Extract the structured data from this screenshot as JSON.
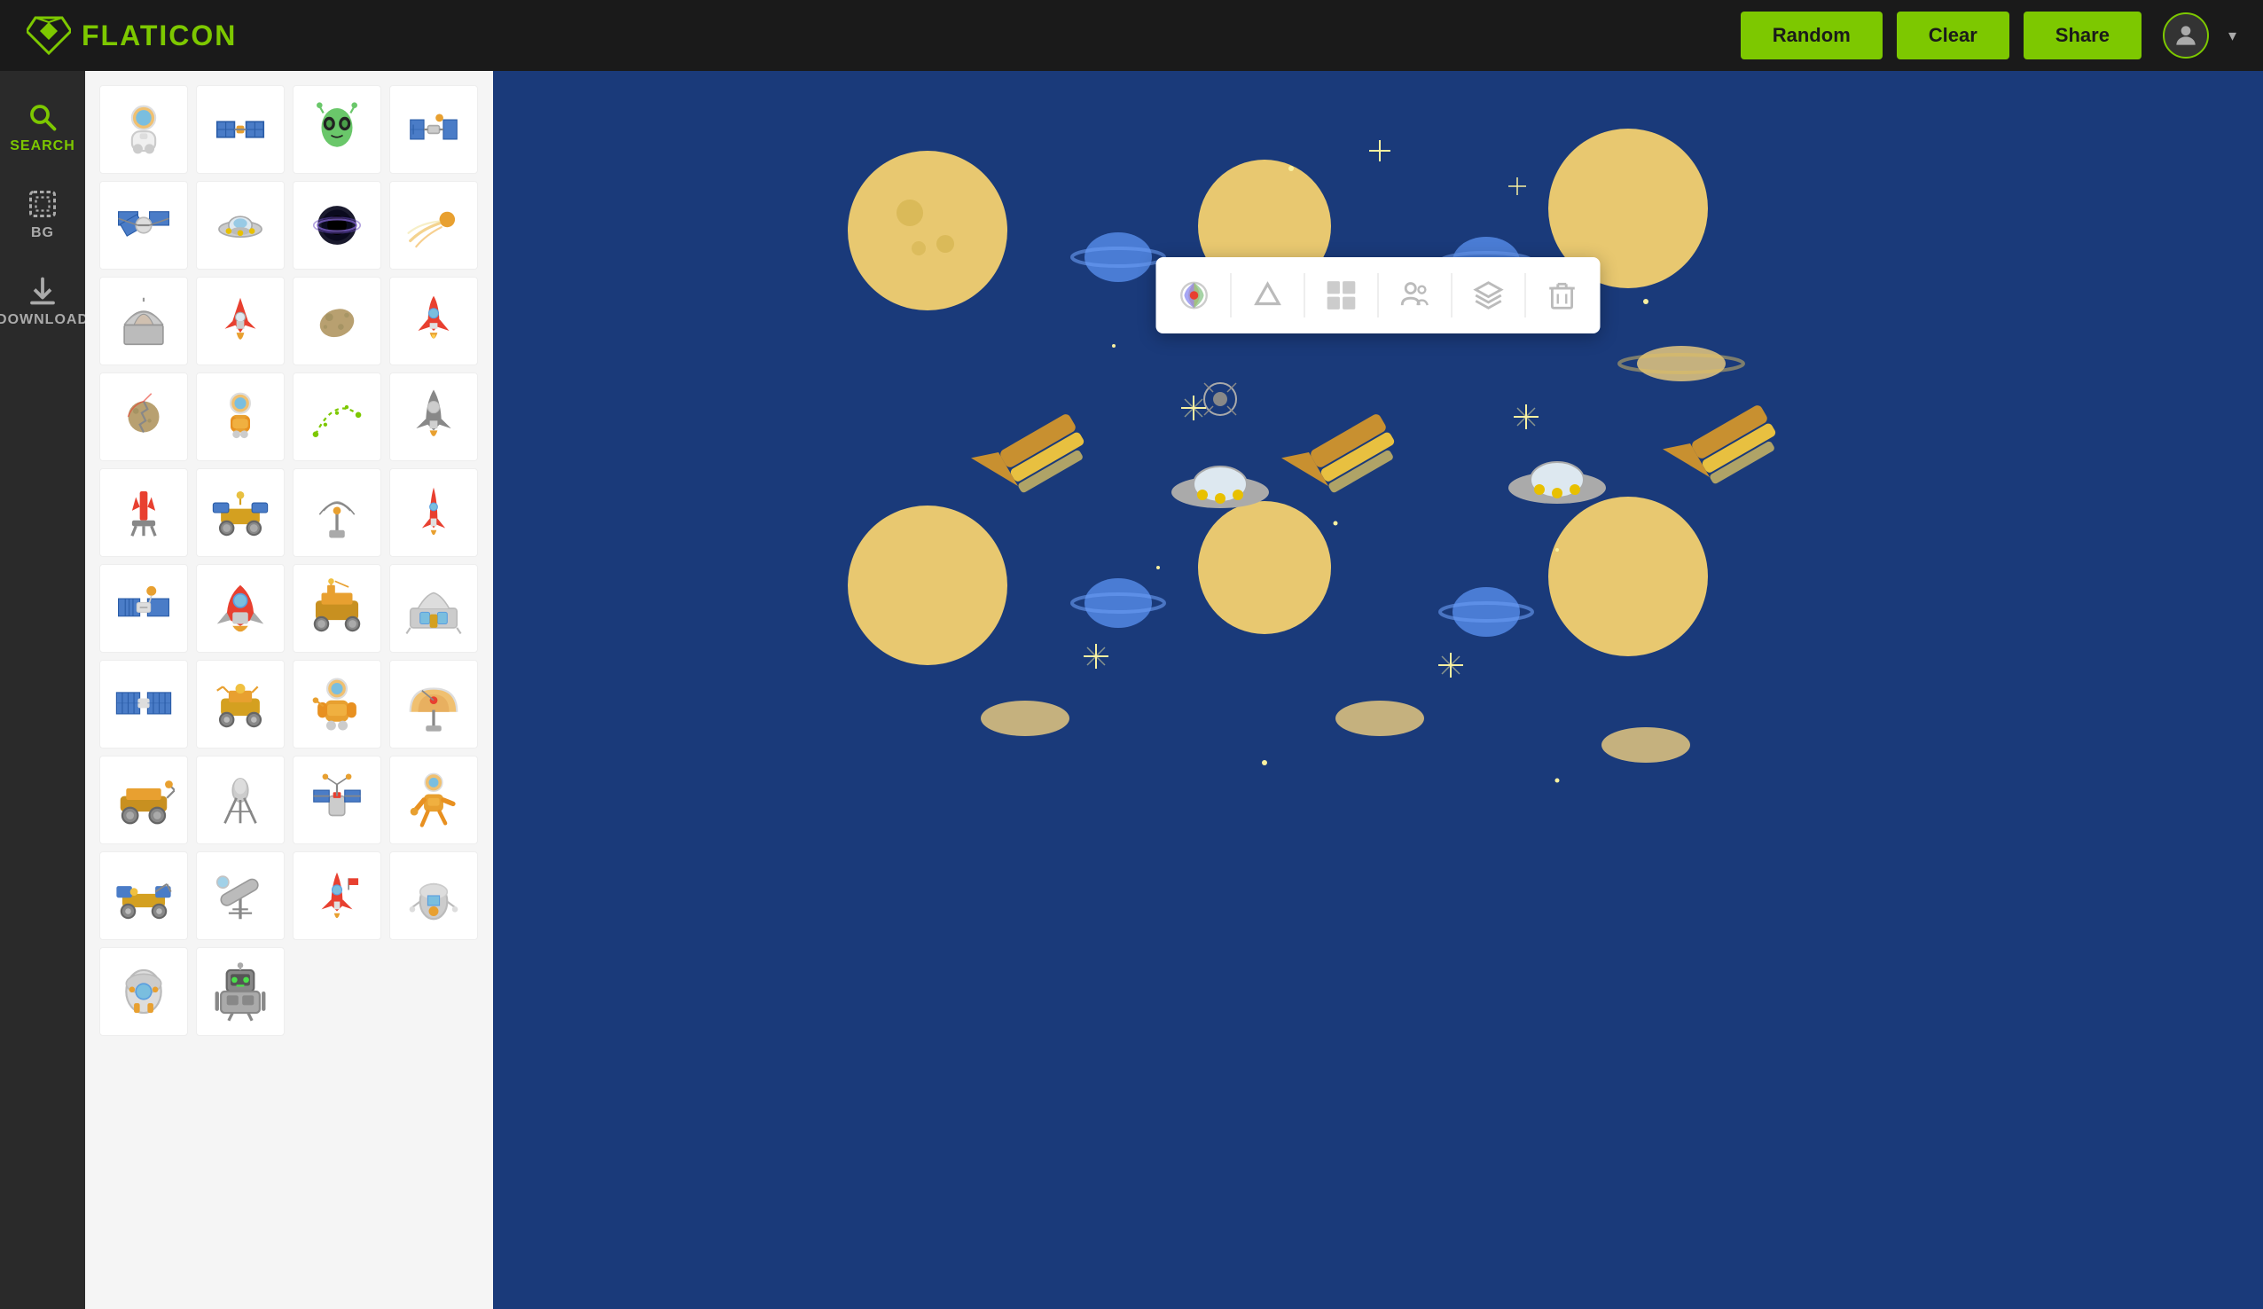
{
  "header": {
    "logo_text": "FLATICON",
    "btn_random": "Random",
    "btn_clear": "Clear",
    "btn_share": "Share"
  },
  "sidebar": {
    "items": [
      {
        "id": "search",
        "label": "SEARCH",
        "active": true
      },
      {
        "id": "bg",
        "label": "BG",
        "active": false
      },
      {
        "id": "download",
        "label": "DOWNLOAD",
        "active": false
      }
    ]
  },
  "toolbar": {
    "buttons": [
      {
        "name": "palette",
        "title": "Color"
      },
      {
        "name": "shape",
        "title": "Shape"
      },
      {
        "name": "pattern",
        "title": "Pattern"
      },
      {
        "name": "people",
        "title": "People"
      },
      {
        "name": "layers",
        "title": "Layers"
      },
      {
        "name": "delete",
        "title": "Delete"
      }
    ]
  },
  "pattern": {
    "background_color": "#1a3a7a"
  }
}
